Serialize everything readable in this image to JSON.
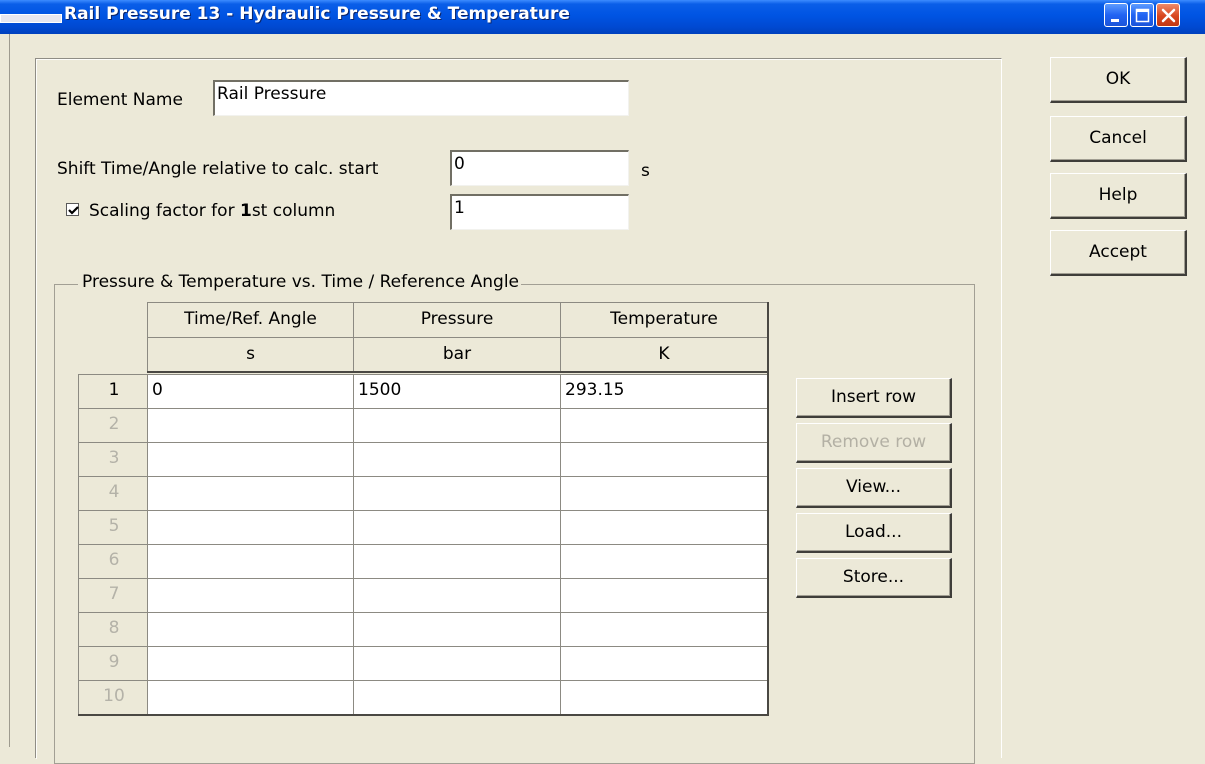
{
  "window": {
    "title": "Rail Pressure 13 - Hydraulic Pressure & Temperature"
  },
  "form": {
    "element_name_label": "Element Name",
    "element_name_value": "Rail Pressure",
    "shift_label": "Shift Time/Angle relative to calc. start",
    "shift_value": "0",
    "shift_unit": "s",
    "scaling_checked": true,
    "scaling_label_pre": "Scaling factor for ",
    "scaling_label_bold": "1",
    "scaling_label_post": "st column",
    "scaling_value": "1"
  },
  "group": {
    "title": "Pressure & Temperature vs. Time / Reference Angle"
  },
  "table": {
    "columns": [
      "Time/Ref. Angle",
      "Pressure",
      "Temperature"
    ],
    "units": [
      "s",
      "bar",
      "K"
    ],
    "row_numbers": [
      "1",
      "2",
      "3",
      "4",
      "5",
      "6",
      "7",
      "8",
      "9",
      "10"
    ],
    "rows": [
      [
        "0",
        "1500",
        "293.15"
      ],
      [
        "",
        "",
        ""
      ],
      [
        "",
        "",
        ""
      ],
      [
        "",
        "",
        ""
      ],
      [
        "",
        "",
        ""
      ],
      [
        "",
        "",
        ""
      ],
      [
        "",
        "",
        ""
      ],
      [
        "",
        "",
        ""
      ],
      [
        "",
        "",
        ""
      ],
      [
        "",
        "",
        ""
      ]
    ]
  },
  "side_buttons": {
    "insert_row": "Insert row",
    "remove_row": "Remove row",
    "view": "View...",
    "load": "Load...",
    "store": "Store..."
  },
  "dialog_buttons": {
    "ok": "OK",
    "cancel": "Cancel",
    "help": "Help",
    "accept": "Accept"
  },
  "colors": {
    "titlebar": "#0054e3",
    "dialog_bg": "#ece9d8",
    "disabled_text": "#b3b0a4"
  }
}
